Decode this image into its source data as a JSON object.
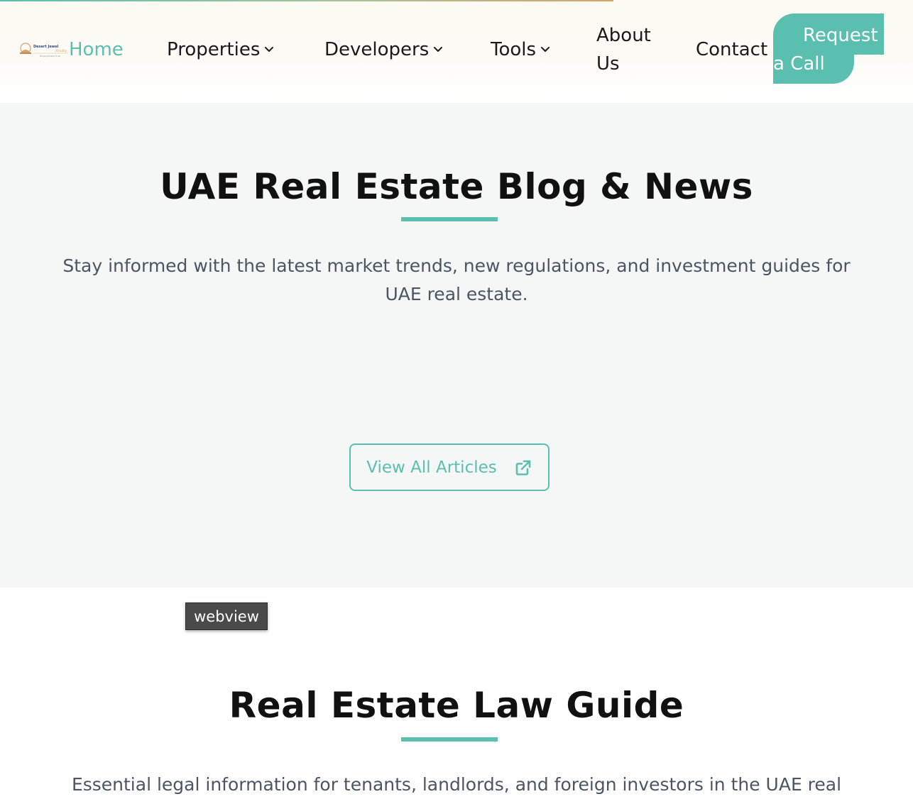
{
  "header": {
    "logo_alt": "Desert Jewel Realty",
    "nav": {
      "home": "Home",
      "properties": "Properties",
      "developers": "Developers",
      "tools": "Tools",
      "about_line1": "About",
      "about_line2": "Us",
      "contact": "Contact"
    },
    "cta": {
      "line1": "Request",
      "line2": "a Call"
    }
  },
  "blog_section": {
    "title": "UAE Real Estate Blog & News",
    "description": "Stay informed with the latest market trends, new regulations, and investment guides for UAE real estate.",
    "button_label": "View All Articles",
    "button_icon": "external-link-icon"
  },
  "tooltip": {
    "label": "webview"
  },
  "law_section": {
    "title": "Real Estate Law Guide",
    "description": "Essential legal information for tenants, landlords, and foreign investors in the UAE real"
  },
  "colors": {
    "accent": "#5bbfb0",
    "text_dark": "#111111",
    "text_muted": "#4b5563",
    "section_bg": "#f5f6f6"
  }
}
